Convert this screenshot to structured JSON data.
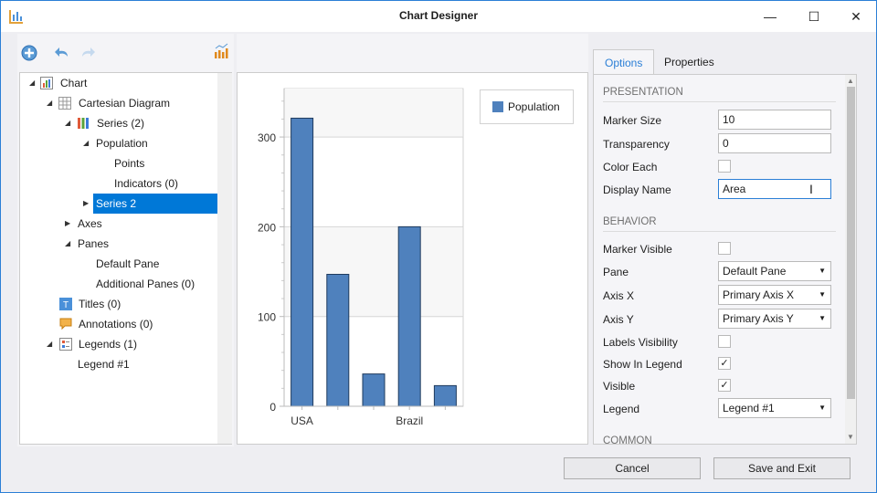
{
  "window": {
    "title": "Chart Designer",
    "minimize": "—",
    "maximize": "☐",
    "close": "✕"
  },
  "tree": {
    "items": [
      {
        "label": "Chart",
        "expanded": true
      },
      {
        "label": "Cartesian Diagram",
        "expanded": true
      },
      {
        "label": "Series (2)",
        "expanded": true
      },
      {
        "label": "Population",
        "expanded": true
      },
      {
        "label": "Points"
      },
      {
        "label": "Indicators (0)"
      },
      {
        "label": "Series 2",
        "expanded": false,
        "selected": true
      },
      {
        "label": "Axes",
        "expanded": false
      },
      {
        "label": "Panes",
        "expanded": true
      },
      {
        "label": "Default Pane"
      },
      {
        "label": "Additional Panes (0)"
      },
      {
        "label": "Titles (0)"
      },
      {
        "label": "Annotations (0)"
      },
      {
        "label": "Legends (1)",
        "expanded": true
      },
      {
        "label": "Legend #1"
      }
    ]
  },
  "chart_data": {
    "type": "bar",
    "categories": [
      "USA",
      "",
      "",
      "Brazil",
      ""
    ],
    "series": [
      {
        "name": "Population",
        "values": [
          321,
          147,
          36,
          200,
          23
        ]
      }
    ],
    "yticks": [
      "0",
      "100",
      "200",
      "300"
    ],
    "ylim": [
      0,
      354
    ],
    "legend": "top-right",
    "bar_color": "#4f81bd",
    "bar_border": "#1f3b5e",
    "grid": true
  },
  "options": {
    "tabs": [
      "Options",
      "Properties"
    ],
    "active_tab": "Options",
    "presentation": "PRESENTATION",
    "marker_size_label": "Marker Size",
    "marker_size": "10",
    "transparency_label": "Transparency",
    "transparency": "0",
    "color_each_label": "Color Each",
    "color_each": false,
    "display_name_label": "Display Name",
    "display_name": "Area",
    "behavior": "BEHAVIOR",
    "marker_visible_label": "Marker Visible",
    "marker_visible": false,
    "pane_label": "Pane",
    "pane": "Default Pane",
    "axis_x_label": "Axis X",
    "axis_x": "Primary Axis X",
    "axis_y_label": "Axis Y",
    "axis_y": "Primary Axis Y",
    "labels_visibility_label": "Labels Visibility",
    "labels_visibility": false,
    "show_in_legend_label": "Show In Legend",
    "show_in_legend": "✓",
    "visible_label": "Visible",
    "visible": "✓",
    "legend_label": "Legend",
    "legend": "Legend #1",
    "common": "COMMON"
  },
  "footer": {
    "cancel": "Cancel",
    "save": "Save and Exit"
  }
}
